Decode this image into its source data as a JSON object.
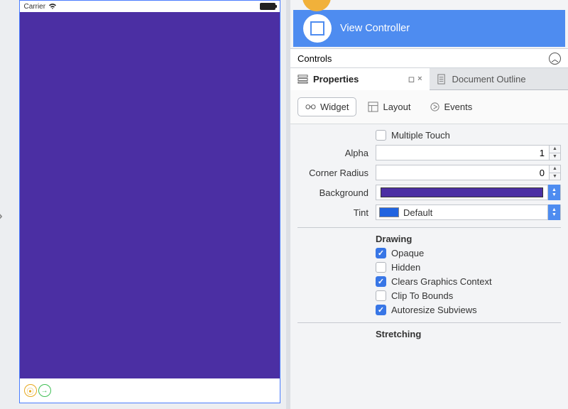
{
  "device": {
    "carrier_label": "Carrier",
    "main_view_color": "#4b2fa3"
  },
  "outline": {
    "selected_item": "View Controller",
    "controls_header": "Controls"
  },
  "tabs": {
    "properties": "Properties",
    "document_outline": "Document Outline"
  },
  "subtabs": {
    "widget": "Widget",
    "layout": "Layout",
    "events": "Events"
  },
  "props": {
    "multiple_touch": {
      "label": "Multiple Touch",
      "checked": false
    },
    "alpha": {
      "label": "Alpha",
      "value": "1"
    },
    "corner_radius": {
      "label": "Corner Radius",
      "value": "0"
    },
    "background": {
      "label": "Background",
      "color": "#4b2fa3"
    },
    "tint": {
      "label": "Tint",
      "text": "Default",
      "swatch": "#2063e0"
    },
    "drawing_header": "Drawing",
    "opaque": {
      "label": "Opaque",
      "checked": true
    },
    "hidden": {
      "label": "Hidden",
      "checked": false
    },
    "clears": {
      "label": "Clears Graphics Context",
      "checked": true
    },
    "clip": {
      "label": "Clip To Bounds",
      "checked": false
    },
    "autoresize": {
      "label": "Autoresize Subviews",
      "checked": true
    },
    "stretching_header": "Stretching"
  }
}
